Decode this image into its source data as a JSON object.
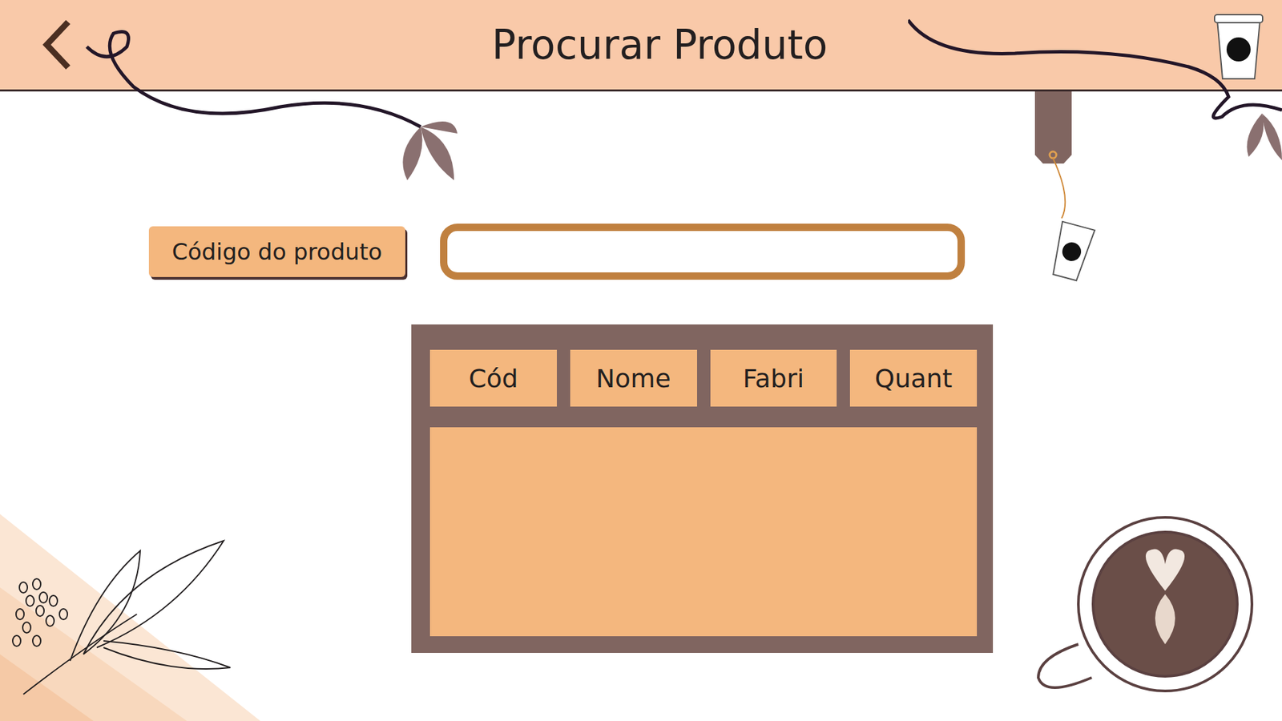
{
  "window": {
    "title": "Procurar Produto"
  },
  "search": {
    "label": "Código do produto",
    "value": ""
  },
  "table": {
    "columns": [
      "Cód",
      "Nome",
      "Fabri",
      "Quant"
    ],
    "rows": []
  }
}
